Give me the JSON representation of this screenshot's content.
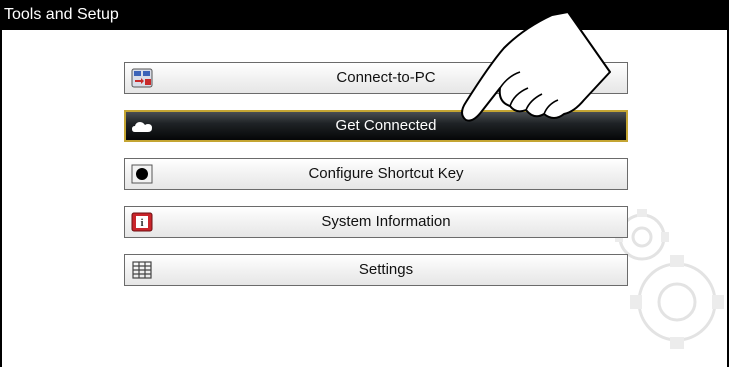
{
  "window": {
    "title": "Tools and Setup"
  },
  "menu": {
    "items": [
      {
        "label": "Connect-to-PC",
        "icon": "connect-to-pc-icon",
        "selected": false
      },
      {
        "label": "Get Connected",
        "icon": "cloud-icon",
        "selected": true
      },
      {
        "label": "Configure Shortcut Key",
        "icon": "shortcut-key-icon",
        "selected": false
      },
      {
        "label": "System Information",
        "icon": "info-icon",
        "selected": false
      },
      {
        "label": "Settings",
        "icon": "settings-grid-icon",
        "selected": false
      }
    ]
  },
  "colors": {
    "titlebar": "#000000",
    "selected_border": "#c4a533",
    "selected_fill": "#1f2326"
  }
}
